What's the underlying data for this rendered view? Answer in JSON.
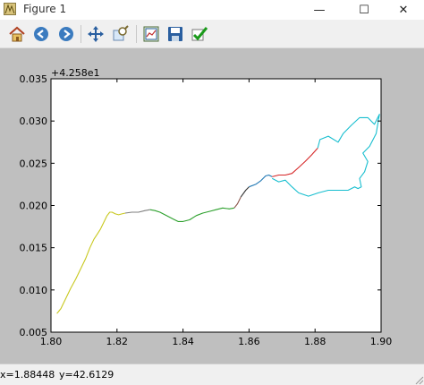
{
  "window": {
    "title": "Figure 1",
    "minimize": "—",
    "maximize": "☐",
    "close": "✕"
  },
  "toolbar": {
    "buttons": [
      {
        "name": "home-icon"
      },
      {
        "name": "back-arrow-icon"
      },
      {
        "name": "forward-arrow-icon"
      },
      {
        "name": "pan-icon"
      },
      {
        "name": "zoom-icon"
      },
      {
        "name": "subplots-icon"
      },
      {
        "name": "save-icon"
      },
      {
        "name": "edit-check-icon"
      }
    ]
  },
  "status": {
    "x": "x=1.88448",
    "y": "y=42.6129"
  },
  "chart_data": {
    "type": "line",
    "offset_label": "+4.258e1",
    "xlim": [
      1.8,
      1.9
    ],
    "ylim": [
      0.005,
      0.035
    ],
    "xticks": [
      "1.80",
      "1.82",
      "1.84",
      "1.86",
      "1.88",
      "1.90"
    ],
    "yticks": [
      "0.005",
      "0.010",
      "0.015",
      "0.020",
      "0.025",
      "0.030",
      "0.035"
    ],
    "grid": false,
    "series": [
      {
        "color": "#c8c81e",
        "points": [
          [
            1.8018,
            0.0072
          ],
          [
            1.8022,
            0.0074
          ],
          [
            1.803,
            0.0078
          ],
          [
            1.8045,
            0.009
          ],
          [
            1.806,
            0.0102
          ],
          [
            1.8075,
            0.0113
          ],
          [
            1.809,
            0.0125
          ],
          [
            1.8105,
            0.0137
          ],
          [
            1.8118,
            0.015
          ],
          [
            1.813,
            0.016
          ],
          [
            1.814,
            0.0166
          ],
          [
            1.815,
            0.0172
          ],
          [
            1.816,
            0.018
          ],
          [
            1.817,
            0.0188
          ],
          [
            1.8178,
            0.0192
          ],
          [
            1.8185,
            0.0192
          ],
          [
            1.8195,
            0.019
          ],
          [
            1.8205,
            0.0189
          ],
          [
            1.8215,
            0.019
          ],
          [
            1.8225,
            0.0191
          ]
        ]
      },
      {
        "color": "#7f7f7f",
        "points": [
          [
            1.8225,
            0.0191
          ],
          [
            1.8245,
            0.0192
          ],
          [
            1.8265,
            0.0192
          ],
          [
            1.8285,
            0.0194
          ],
          [
            1.83,
            0.0195
          ]
        ]
      },
      {
        "color": "#2ca02c",
        "points": [
          [
            1.83,
            0.0195
          ],
          [
            1.8315,
            0.0194
          ],
          [
            1.833,
            0.0192
          ],
          [
            1.835,
            0.0188
          ],
          [
            1.837,
            0.0184
          ],
          [
            1.8385,
            0.0181
          ],
          [
            1.84,
            0.0181
          ],
          [
            1.842,
            0.0183
          ],
          [
            1.844,
            0.0188
          ],
          [
            1.846,
            0.0191
          ],
          [
            1.848,
            0.0193
          ],
          [
            1.85,
            0.0195
          ],
          [
            1.852,
            0.0197
          ],
          [
            1.854,
            0.0196
          ],
          [
            1.8555,
            0.0197
          ]
        ]
      },
      {
        "color": "#8c564b",
        "points": [
          [
            1.8555,
            0.0197
          ],
          [
            1.8565,
            0.0202
          ],
          [
            1.8575,
            0.021
          ]
        ]
      },
      {
        "color": "#333333",
        "points": [
          [
            1.8575,
            0.021
          ],
          [
            1.859,
            0.0218
          ],
          [
            1.86,
            0.0222
          ]
        ]
      },
      {
        "color": "#1f77b4",
        "points": [
          [
            1.86,
            0.0222
          ],
          [
            1.862,
            0.0225
          ],
          [
            1.8635,
            0.0229
          ],
          [
            1.865,
            0.0235
          ],
          [
            1.866,
            0.0236
          ],
          [
            1.867,
            0.0234
          ]
        ]
      },
      {
        "color": "#d62728",
        "points": [
          [
            1.867,
            0.0234
          ],
          [
            1.869,
            0.0236
          ],
          [
            1.871,
            0.0236
          ],
          [
            1.873,
            0.0238
          ],
          [
            1.875,
            0.0245
          ],
          [
            1.877,
            0.0252
          ],
          [
            1.879,
            0.026
          ],
          [
            1.8808,
            0.0268
          ]
        ]
      },
      {
        "color": "#17becf",
        "points": [
          [
            1.8808,
            0.0268
          ],
          [
            1.8815,
            0.0278
          ],
          [
            1.884,
            0.0282
          ],
          [
            1.887,
            0.0275
          ],
          [
            1.8885,
            0.0285
          ],
          [
            1.891,
            0.0295
          ],
          [
            1.8935,
            0.0304
          ],
          [
            1.896,
            0.0304
          ],
          [
            1.898,
            0.0296
          ],
          [
            1.8995,
            0.0308
          ],
          [
            1.8985,
            0.0285
          ],
          [
            1.8965,
            0.027
          ],
          [
            1.8945,
            0.0262
          ],
          [
            1.896,
            0.0252
          ],
          [
            1.895,
            0.024
          ],
          [
            1.8935,
            0.0232
          ],
          [
            1.894,
            0.0222
          ],
          [
            1.893,
            0.022
          ],
          [
            1.892,
            0.0222
          ],
          [
            1.89,
            0.0218
          ],
          [
            1.887,
            0.0218
          ],
          [
            1.884,
            0.0218
          ],
          [
            1.881,
            0.0215
          ],
          [
            1.878,
            0.0211
          ],
          [
            1.875,
            0.0215
          ],
          [
            1.873,
            0.0222
          ],
          [
            1.871,
            0.023
          ],
          [
            1.869,
            0.0228
          ],
          [
            1.867,
            0.0232
          ]
        ]
      }
    ]
  }
}
